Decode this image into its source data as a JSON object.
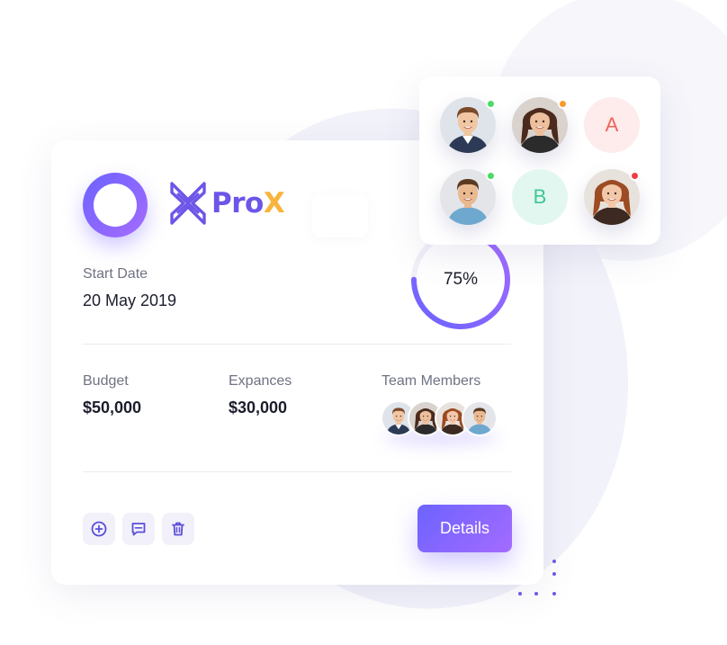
{
  "project": {
    "brand_pro": "Pro",
    "brand_x": "X",
    "start_date_label": "Start Date",
    "start_date_value": "20 May 2019",
    "progress_text": "75%",
    "progress_fraction": 0.75,
    "budget_label": "Budget",
    "budget_value": "$50,000",
    "expenses_label": "Expances",
    "expenses_value": "$30,000",
    "team_label": "Team Members",
    "team_avatars": [
      "man-suit",
      "woman-brunette",
      "woman-redhead",
      "man-casual"
    ],
    "actions": [
      {
        "name": "add-icon"
      },
      {
        "name": "comment-icon"
      },
      {
        "name": "trash-icon"
      }
    ],
    "details_button": "Details"
  },
  "members_panel": {
    "members": [
      {
        "kind": "photo",
        "avatar": "man-suit",
        "status": "online"
      },
      {
        "kind": "photo",
        "avatar": "woman-brunette",
        "status": "away"
      },
      {
        "kind": "initial",
        "letter": "A",
        "bg": "#fdeceb",
        "fg": "#f0645a"
      },
      {
        "kind": "photo",
        "avatar": "man-casual",
        "status": "online"
      },
      {
        "kind": "initial",
        "letter": "B",
        "bg": "#e2f7ef",
        "fg": "#3cc796"
      },
      {
        "kind": "photo",
        "avatar": "woman-redhead",
        "status": "busy"
      }
    ]
  },
  "colors": {
    "accent": "#6c63ff",
    "accent_end": "#a56bff",
    "brand_x": "#f8b43d",
    "online": "#4cd964",
    "away": "#f89a2b",
    "busy": "#f03e46"
  }
}
